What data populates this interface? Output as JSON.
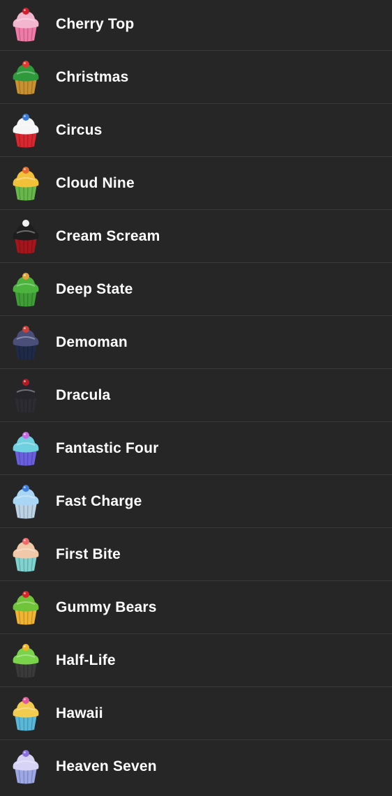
{
  "items": [
    {
      "label": "Cherry Top",
      "icon": "cherry-top-cupcake-icon",
      "frosting": "#f3b6cf",
      "cup": "#f07aa8",
      "accent": "#d01f2f"
    },
    {
      "label": "Christmas",
      "icon": "christmas-cupcake-icon",
      "frosting": "#2f9a3b",
      "cup": "#c9912f",
      "accent": "#e23a2e"
    },
    {
      "label": "Circus",
      "icon": "circus-cupcake-icon",
      "frosting": "#f5f5f5",
      "cup": "#d9262f",
      "accent": "#3a7bd5"
    },
    {
      "label": "Cloud Nine",
      "icon": "cloud-nine-cupcake-icon",
      "frosting": "#f2c13a",
      "cup": "#67b84a",
      "accent": "#e56c2a"
    },
    {
      "label": "Cream Scream",
      "icon": "cream-scream-cupcake-icon",
      "frosting": "#1e1e1e",
      "cup": "#a5151c",
      "accent": "#f0f0f0"
    },
    {
      "label": "Deep State",
      "icon": "deep-state-cupcake-icon",
      "frosting": "#4bb33e",
      "cup": "#3f9e35",
      "accent": "#e0a53a"
    },
    {
      "label": "Demoman",
      "icon": "demoman-cupcake-icon",
      "frosting": "#4a4f7a",
      "cup": "#1f2a48",
      "accent": "#c9413a"
    },
    {
      "label": "Dracula",
      "icon": "dracula-cupcake-icon",
      "frosting": "#25252b",
      "cup": "#2c2c32",
      "accent": "#b31b23"
    },
    {
      "label": "Fantastic Four",
      "icon": "fantastic-four-cupcake-icon",
      "frosting": "#6fd0e0",
      "cup": "#6a5fe0",
      "accent": "#c56ae0"
    },
    {
      "label": "Fast Charge",
      "icon": "fast-charge-cupcake-icon",
      "frosting": "#a9d6f5",
      "cup": "#bcd3e6",
      "accent": "#3f7fe0"
    },
    {
      "label": "First Bite",
      "icon": "first-bite-cupcake-icon",
      "frosting": "#f2c9a8",
      "cup": "#7fd3d0",
      "accent": "#f06a6a"
    },
    {
      "label": "Gummy Bears",
      "icon": "gummy-bears-cupcake-icon",
      "frosting": "#6fc43a",
      "cup": "#f2b533",
      "accent": "#d6262c"
    },
    {
      "label": "Half-Life",
      "icon": "half-life-cupcake-icon",
      "frosting": "#7ad44a",
      "cup": "#3a3a3a",
      "accent": "#f2b82a"
    },
    {
      "label": "Hawaii",
      "icon": "hawaii-cupcake-icon",
      "frosting": "#f2cc4f",
      "cup": "#59b9d9",
      "accent": "#e05a9a"
    },
    {
      "label": "Heaven Seven",
      "icon": "heaven-seven-cupcake-icon",
      "frosting": "#d7d3f5",
      "cup": "#9ea8e6",
      "accent": "#8a6fe0"
    }
  ]
}
